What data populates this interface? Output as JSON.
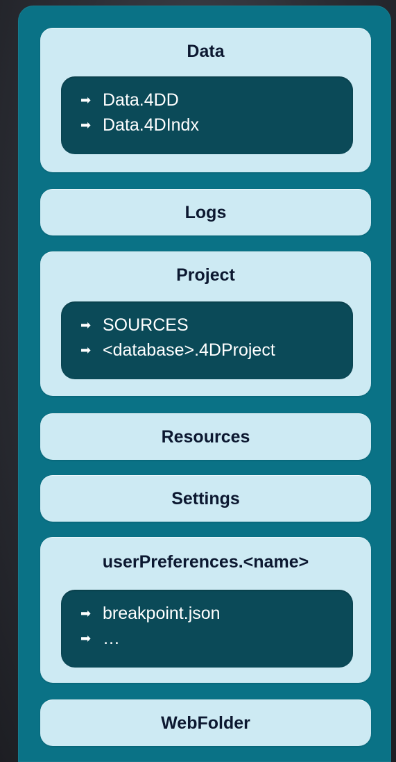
{
  "folders": {
    "data": {
      "title": "Data",
      "items": [
        "Data.4DD",
        "Data.4DIndx"
      ]
    },
    "logs": {
      "title": "Logs"
    },
    "project": {
      "title": "Project",
      "items": [
        "SOURCES",
        "<database>.4DProject"
      ]
    },
    "resources": {
      "title": "Resources"
    },
    "settings": {
      "title": "Settings"
    },
    "user_preferences": {
      "title": "userPreferences.<name>",
      "items": [
        "breakpoint.json",
        "…"
      ]
    },
    "webfolder": {
      "title": "WebFolder"
    }
  },
  "arrow_glyph": "➡"
}
